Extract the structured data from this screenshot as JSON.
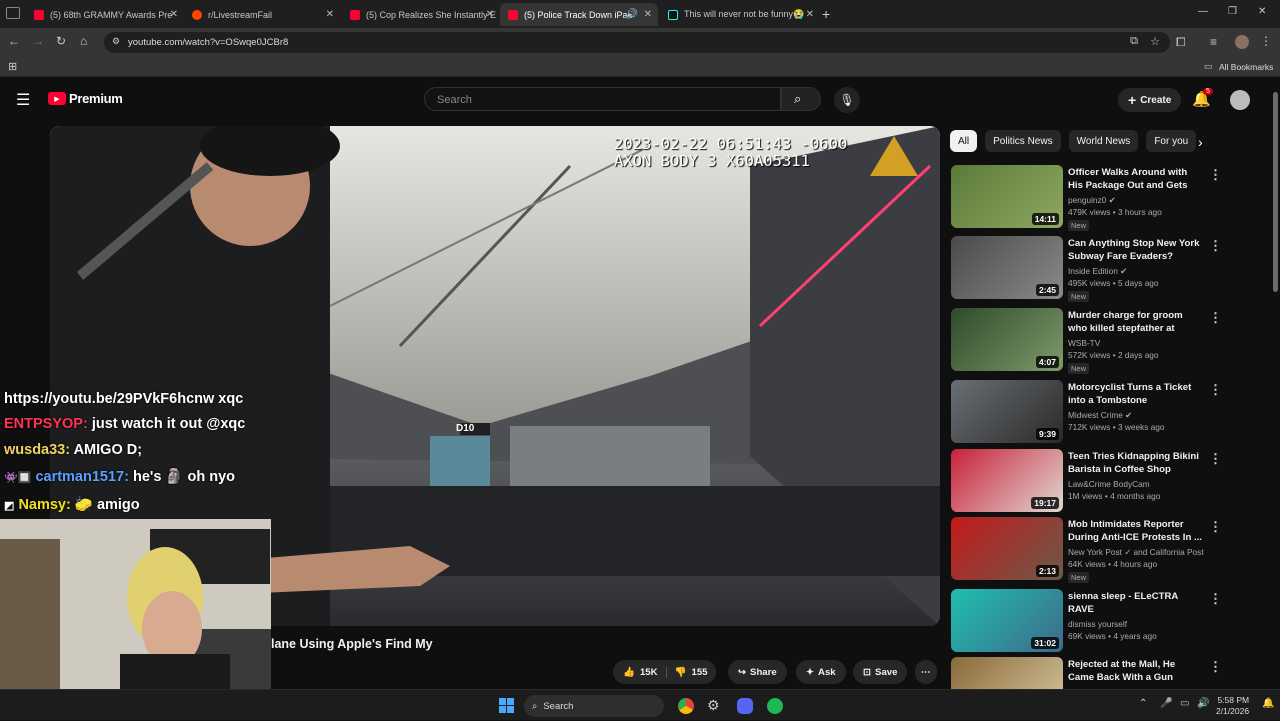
{
  "browser": {
    "tabs": [
      {
        "title": "(5) 68th GRAMMY Awards Pre",
        "fav": "#ff0033"
      },
      {
        "title": "r/LivestreamFail",
        "fav": "#ff4500"
      },
      {
        "title": "(5) Cop Realizes She Instantly E",
        "fav": "#ff0033"
      },
      {
        "title": "(5) Police Track Down iPad",
        "fav": "#ff0033"
      },
      {
        "title": "This will never not be funny😭",
        "fav": "#25f4ee"
      }
    ],
    "url": "youtube.com/watch?v=OSwqe0JCBr8",
    "bookmarks_label": "All Bookmarks"
  },
  "youtube": {
    "logo_text": "Premium",
    "search_placeholder": "Search",
    "create_label": "Create",
    "notif_count": "5",
    "chips": [
      "All",
      "Politics News",
      "World News",
      "For you"
    ],
    "video": {
      "timestamp": "2023-02-22 06:51:43 -0600",
      "device": "AXON BODY 3 X60A05311",
      "sign": "D10",
      "title_fragment": "lane Using Apple's Find My"
    },
    "actions": {
      "likes": "15K",
      "dislikes": "155",
      "share": "Share",
      "ask": "Ask",
      "save": "Save"
    },
    "recommendations": [
      {
        "title": "Officer Walks Around with His Package Out and Gets Arrested",
        "channel": "penguinz0",
        "verified": true,
        "meta": "479K views • 3 hours ago",
        "badge": "New",
        "duration": "14:11",
        "colors": [
          "#5b7a3a",
          "#8fa860"
        ]
      },
      {
        "title": "Can Anything Stop New York Subway Fare Evaders?",
        "channel": "Inside Edition",
        "verified": true,
        "meta": "495K views • 5 days ago",
        "badge": "New",
        "duration": "2:45",
        "colors": [
          "#4a4a4a",
          "#8a8a8a"
        ]
      },
      {
        "title": "Murder charge for groom who killed stepfather at wedding; ...",
        "channel": "WSB-TV",
        "verified": false,
        "meta": "572K views • 2 days ago",
        "badge": "New",
        "duration": "4:07",
        "colors": [
          "#2f4a2a",
          "#7f9a6a"
        ]
      },
      {
        "title": "Motorcyclist Turns a Ticket into a Tombstone",
        "channel": "Midwest Crime",
        "verified": true,
        "meta": "712K views • 3 weeks ago",
        "badge": "",
        "duration": "9:39",
        "colors": [
          "#6a6f74",
          "#2a2a2a"
        ]
      },
      {
        "title": "Teen Tries Kidnapping Bikini Barista in Coffee Shop Drive-...",
        "channel": "Law&Crime BodyCam",
        "verified": false,
        "meta": "1M views • 4 months ago",
        "badge": "",
        "duration": "19:17",
        "colors": [
          "#c8203a",
          "#e0d8d0"
        ]
      },
      {
        "title": "Mob Intimidates Reporter During Anti-ICE Protests In ...",
        "channel": "New York Post ✓ and California Post",
        "verified": false,
        "meta": "64K views • 4 hours ago",
        "badge": "New",
        "duration": "2:13",
        "colors": [
          "#c41a1a",
          "#6a5a4a"
        ]
      },
      {
        "title": "sienna sleep - ELeCTRA RAVE",
        "channel": "dismiss yourself",
        "verified": false,
        "meta": "69K views • 4 years ago",
        "badge": "",
        "duration": "31:02",
        "colors": [
          "#1fbfb0",
          "#3e6a8a"
        ]
      },
      {
        "title": "Rejected at the Mall, He Came Back With a Gun",
        "channel": "",
        "verified": false,
        "meta": "",
        "badge": "",
        "duration": "",
        "colors": [
          "#8a6a3a",
          "#d8c8a0"
        ]
      }
    ]
  },
  "chat": [
    {
      "user": "",
      "user_color": "#ffffff",
      "text": "https://youtu.be/29PVkF6hcnw xqc"
    },
    {
      "user": "ENTPSYOP:",
      "user_color": "#ff3355",
      "text": " just watch it out @xqc"
    },
    {
      "user": "wusda33:",
      "user_color": "#f0d264",
      "text": " AMIGO D;"
    },
    {
      "user": "cartman1517:",
      "user_color": "#5aa0ff",
      "text": " he's  🗿  oh nyo"
    },
    {
      "user": "Namsy:",
      "user_color": "#f0e020",
      "text": "  🧽  amigo"
    }
  ],
  "taskbar": {
    "search_label": "Search",
    "time": "5:58 PM",
    "date": "2/1/2026"
  }
}
